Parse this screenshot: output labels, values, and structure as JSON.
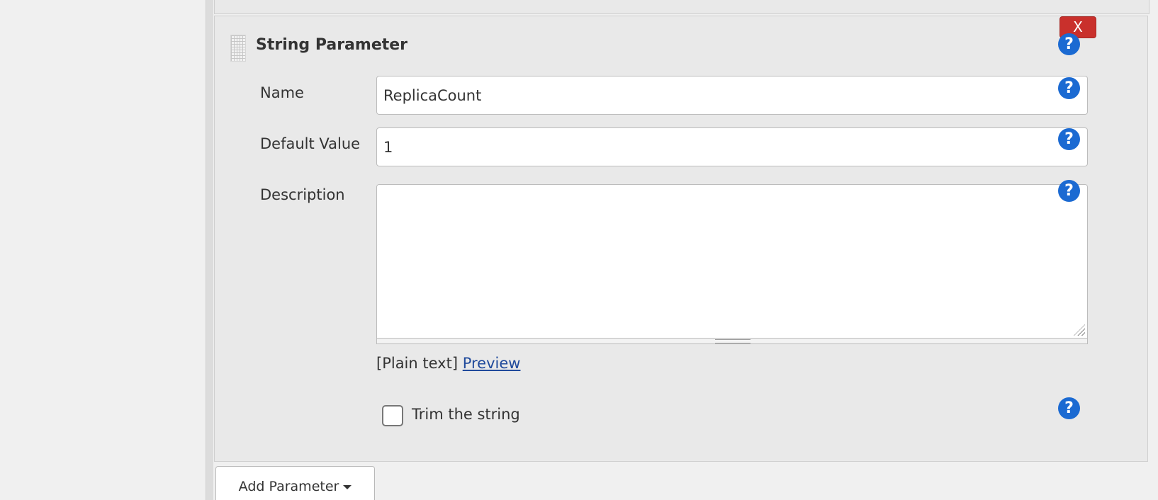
{
  "parameter": {
    "title": "String Parameter",
    "delete_label": "X",
    "fields": {
      "name_label": "Name",
      "name_value": "ReplicaCount",
      "default_label": "Default Value",
      "default_value": "1",
      "description_label": "Description",
      "description_value": ""
    },
    "markup": {
      "plain_text": "[Plain text]",
      "preview_link": "Preview"
    },
    "trim": {
      "label": "Trim the string",
      "checked": false
    },
    "help_glyph": "?"
  },
  "footer": {
    "add_parameter_label": "Add Parameter"
  },
  "icons": {
    "help": "help-icon",
    "drag": "drag-handle-icon",
    "caret": "chevron-down-icon"
  },
  "colors": {
    "delete_button": "#c9302c",
    "help_icon": "#1b6ad2",
    "link": "#204a9c"
  }
}
